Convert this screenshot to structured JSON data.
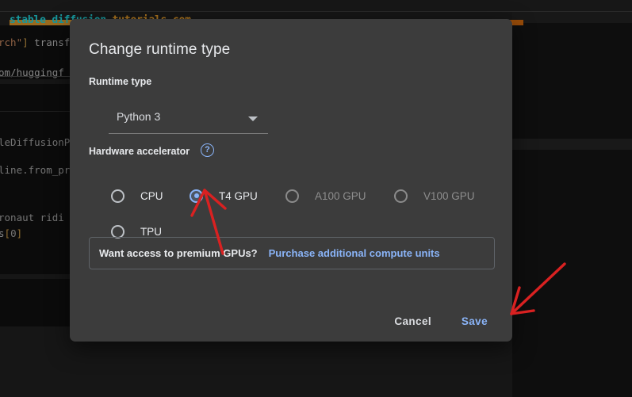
{
  "watermark": {
    "part1": "stable diffusion ",
    "part2": "tutorials.com",
    "color1": "#22d8e0",
    "color2": "#f0a32c"
  },
  "background": {
    "code_lines": [
      "rch\"] transf",
      "om/huggingf",
      "leDiffusionP",
      "line.from_pr",
      "ronaut ridi",
      "s[0]"
    ]
  },
  "dialog": {
    "title": "Change runtime type",
    "runtime_section": {
      "label": "Runtime type",
      "select": {
        "value": "Python 3",
        "options": [
          "Python 3"
        ]
      }
    },
    "hardware_section": {
      "label": "Hardware accelerator",
      "help_icon_glyph": "?",
      "options": [
        {
          "label": "CPU",
          "checked": false,
          "disabled": false
        },
        {
          "label": "T4 GPU",
          "checked": true,
          "disabled": false
        },
        {
          "label": "A100 GPU",
          "checked": false,
          "disabled": true
        },
        {
          "label": "V100 GPU",
          "checked": false,
          "disabled": true
        },
        {
          "label": "TPU",
          "checked": false,
          "disabled": false
        }
      ]
    },
    "promo": {
      "text": "Want access to premium GPUs?",
      "link": "Purchase additional compute units"
    },
    "actions": {
      "cancel": "Cancel",
      "save": "Save"
    }
  },
  "colors": {
    "accent_blue": "#8ab4f8",
    "dialog_bg": "#3c3c3c",
    "annotation_red": "#d92121",
    "text_primary": "#e8eaed",
    "text_disabled": "#8e8e8e"
  }
}
